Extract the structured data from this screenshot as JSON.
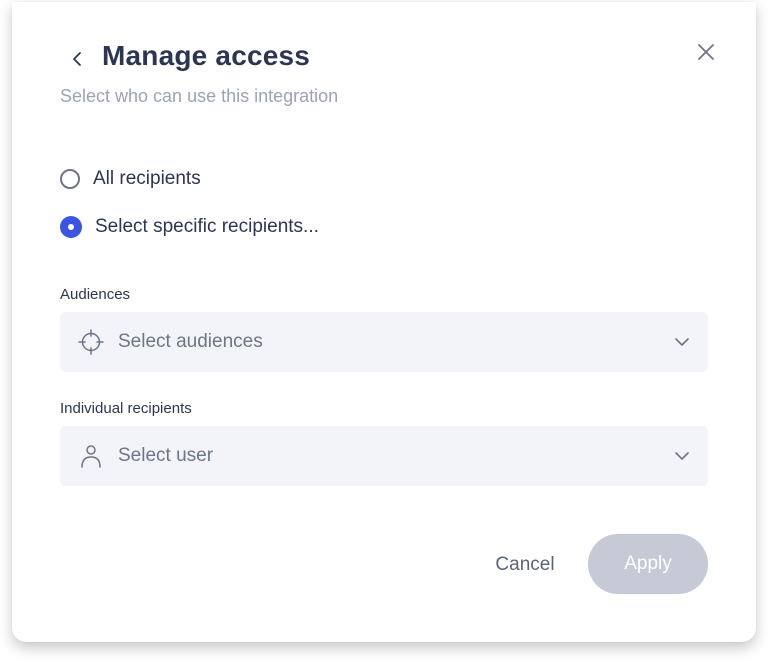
{
  "dialog": {
    "title": "Manage access",
    "subtitle": "Select who can use this integration",
    "back_icon": "chevron-left-icon",
    "close_icon": "close-icon"
  },
  "options": [
    {
      "label": "All recipients",
      "checked": false
    },
    {
      "label": "Select specific recipients...",
      "checked": true
    }
  ],
  "audiences": {
    "label": "Audiences",
    "placeholder": "Select audiences",
    "icon": "crosshair-icon"
  },
  "individual": {
    "label": "Individual recipients",
    "placeholder": "Select user",
    "icon": "user-icon"
  },
  "footer": {
    "cancel_label": "Cancel",
    "apply_label": "Apply"
  },
  "colors": {
    "accent": "#3a56e0",
    "title": "#2c3650",
    "muted": "#9ba3b5",
    "field_bg": "#f2f4fa",
    "disabled_button": "#c5cad6"
  }
}
